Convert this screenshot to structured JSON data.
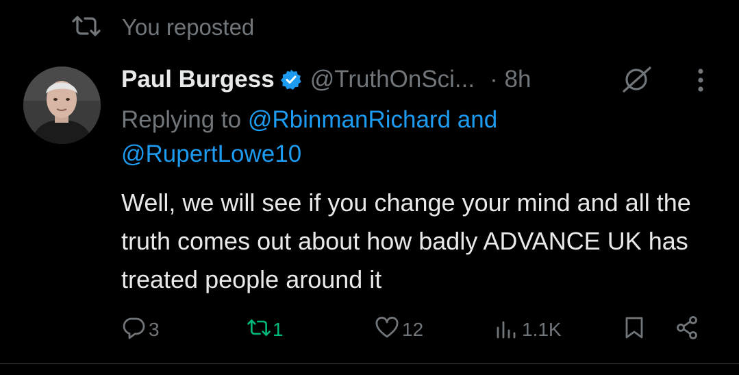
{
  "repost_header": {
    "label": "You reposted"
  },
  "tweet": {
    "author_name": "Paul Burgess",
    "handle": "@TruthOnSci...",
    "time": "· 8h",
    "replying_prefix": "Replying to",
    "replying_to_1": "@RbinmanRichard",
    "replying_and": "and",
    "replying_to_2": "@RupertLowe10",
    "text": "Well, we will see if you change your mind and all the truth comes out about how badly ADVANCE UK has treated people around it"
  },
  "actions": {
    "replies": "3",
    "reposts": "1",
    "likes": "12",
    "views": "1.1K"
  },
  "colors": {
    "background": "#000000",
    "text": "#e7e9ea",
    "muted": "#71767b",
    "link": "#1d9bf0",
    "repost_active": "#00ba7c",
    "verified": "#1d9bf0"
  }
}
